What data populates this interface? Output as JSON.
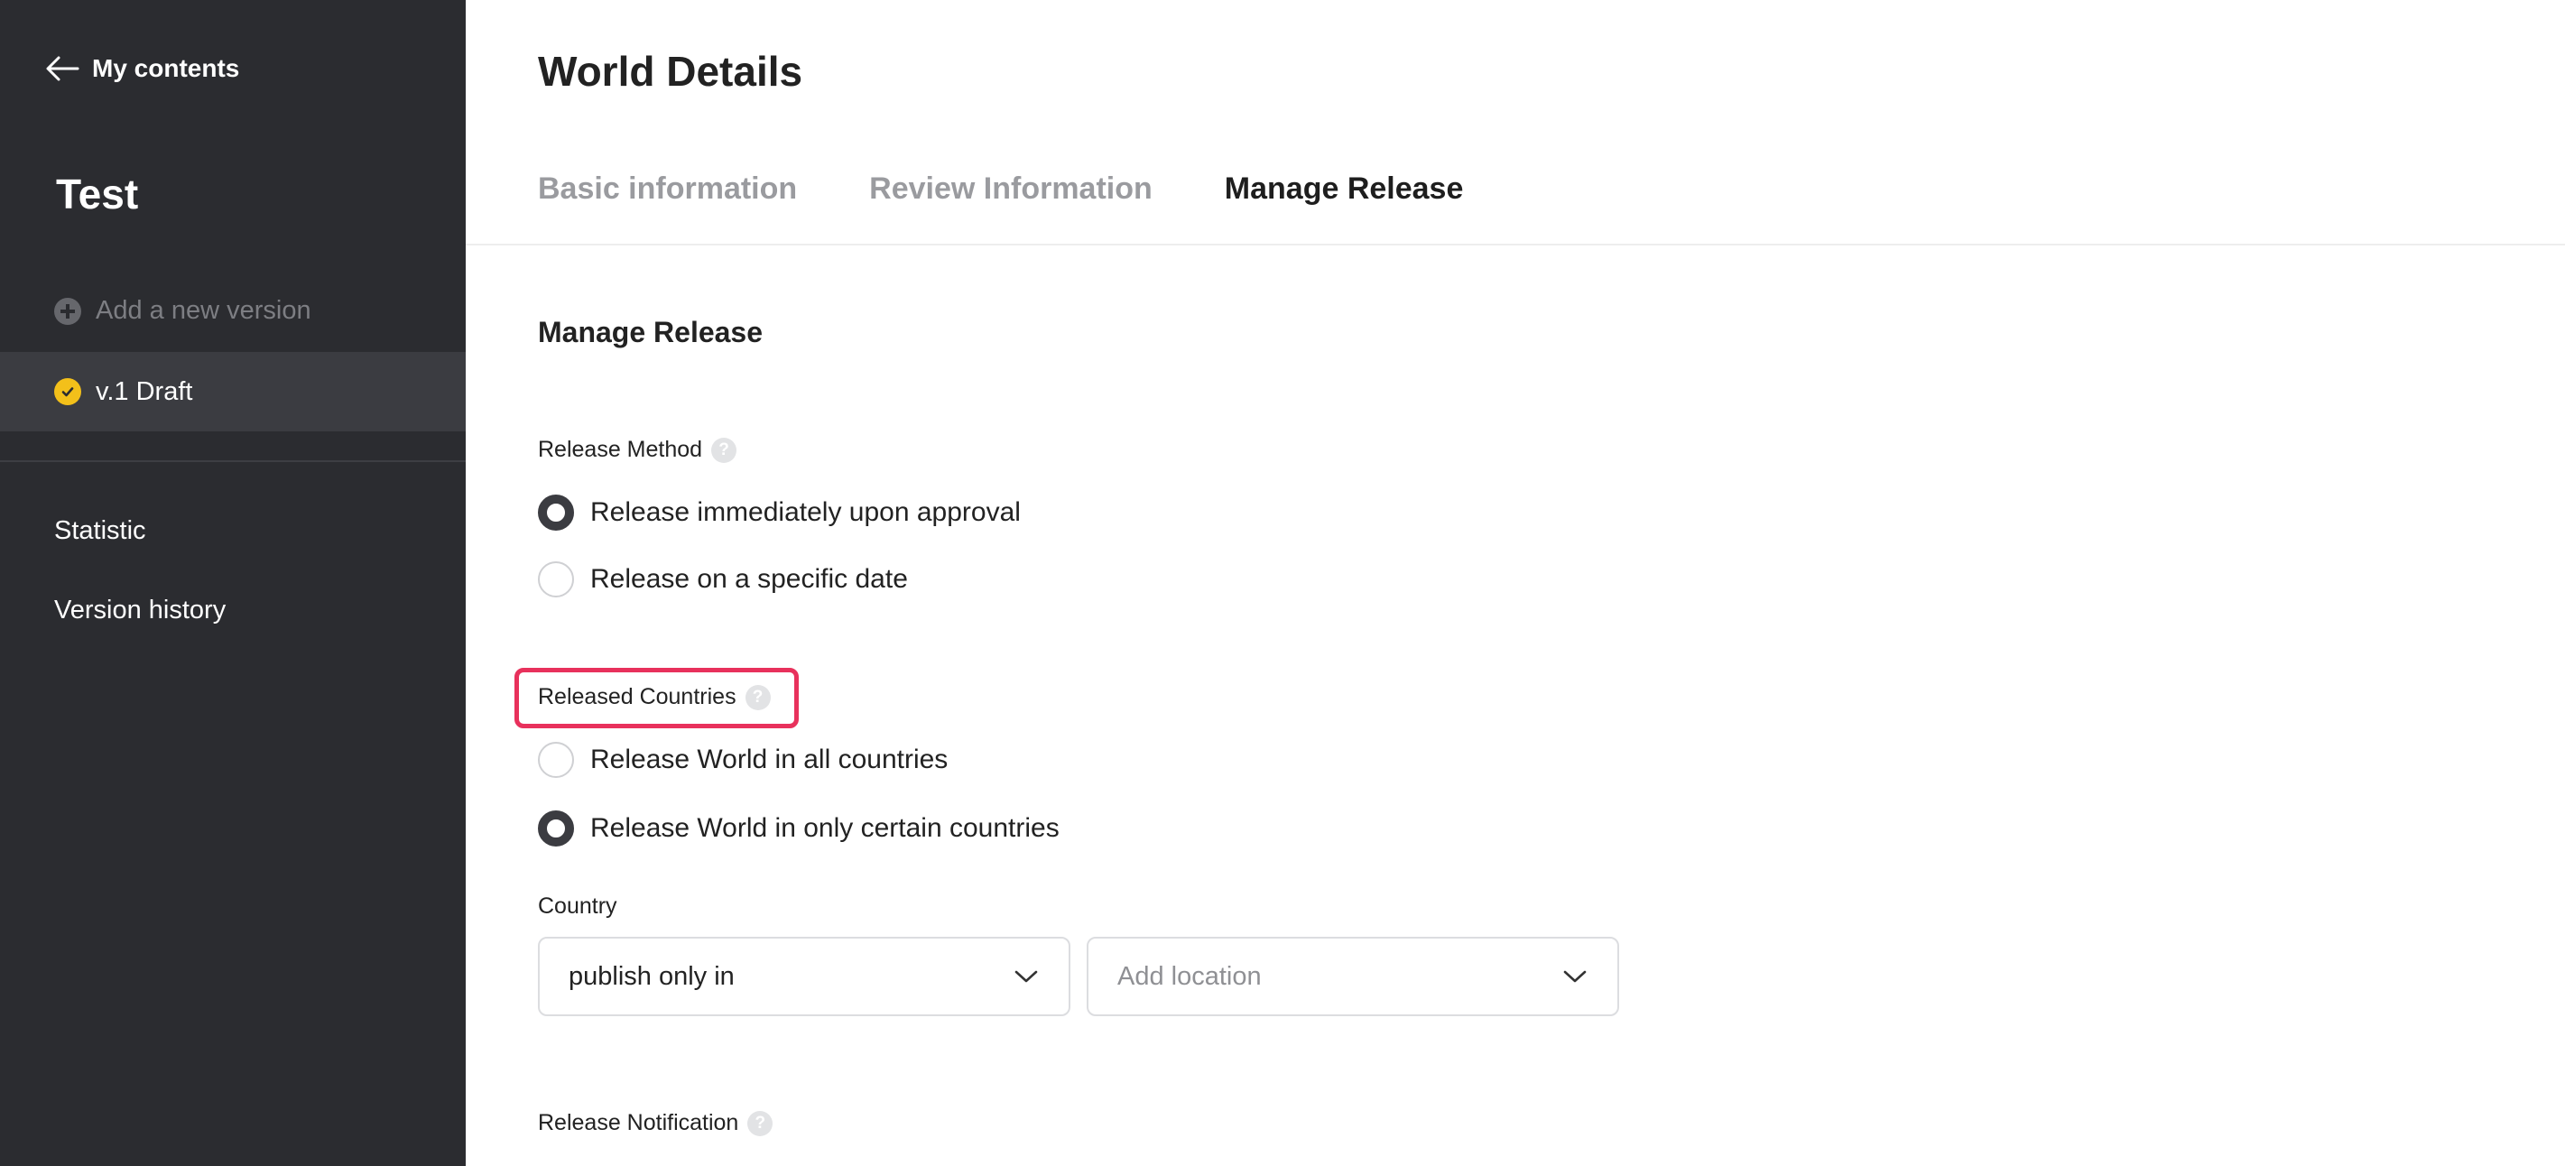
{
  "sidebar": {
    "back_label": "My contents",
    "project_title": "Test",
    "add_version_label": "Add a new version",
    "version_label": "v.1 Draft",
    "nav": [
      "Statistic",
      "Version history"
    ]
  },
  "header": {
    "page_title": "World Details",
    "tabs": [
      {
        "label": "Basic information",
        "active": false
      },
      {
        "label": "Review Information",
        "active": false
      },
      {
        "label": "Manage Release",
        "active": true
      }
    ]
  },
  "content": {
    "section_title": "Manage Release",
    "release_method": {
      "label": "Release Method",
      "options": [
        {
          "label": "Release immediately upon approval",
          "selected": true
        },
        {
          "label": "Release on a specific date",
          "selected": false
        }
      ]
    },
    "released_countries": {
      "label": "Released Countries",
      "options": [
        {
          "label": "Release World in all countries",
          "selected": false
        },
        {
          "label": "Release World in only certain countries",
          "selected": true
        }
      ]
    },
    "country": {
      "label": "Country",
      "mode_value": "publish only in",
      "location_placeholder": "Add location"
    },
    "release_notification": {
      "label": "Release Notification"
    },
    "help_glyph": "?"
  },
  "colors": {
    "sidebar_bg": "#2b2c30",
    "selected_version_bg": "#3b3c41",
    "draft_badge": "#f3c01a",
    "highlight_border": "#e8315c"
  },
  "icons": {
    "back": "arrow-left-icon",
    "add": "plus-circle-icon",
    "status": "check-circle-icon",
    "help": "question-circle-icon",
    "dropdown": "chevron-down-icon"
  }
}
